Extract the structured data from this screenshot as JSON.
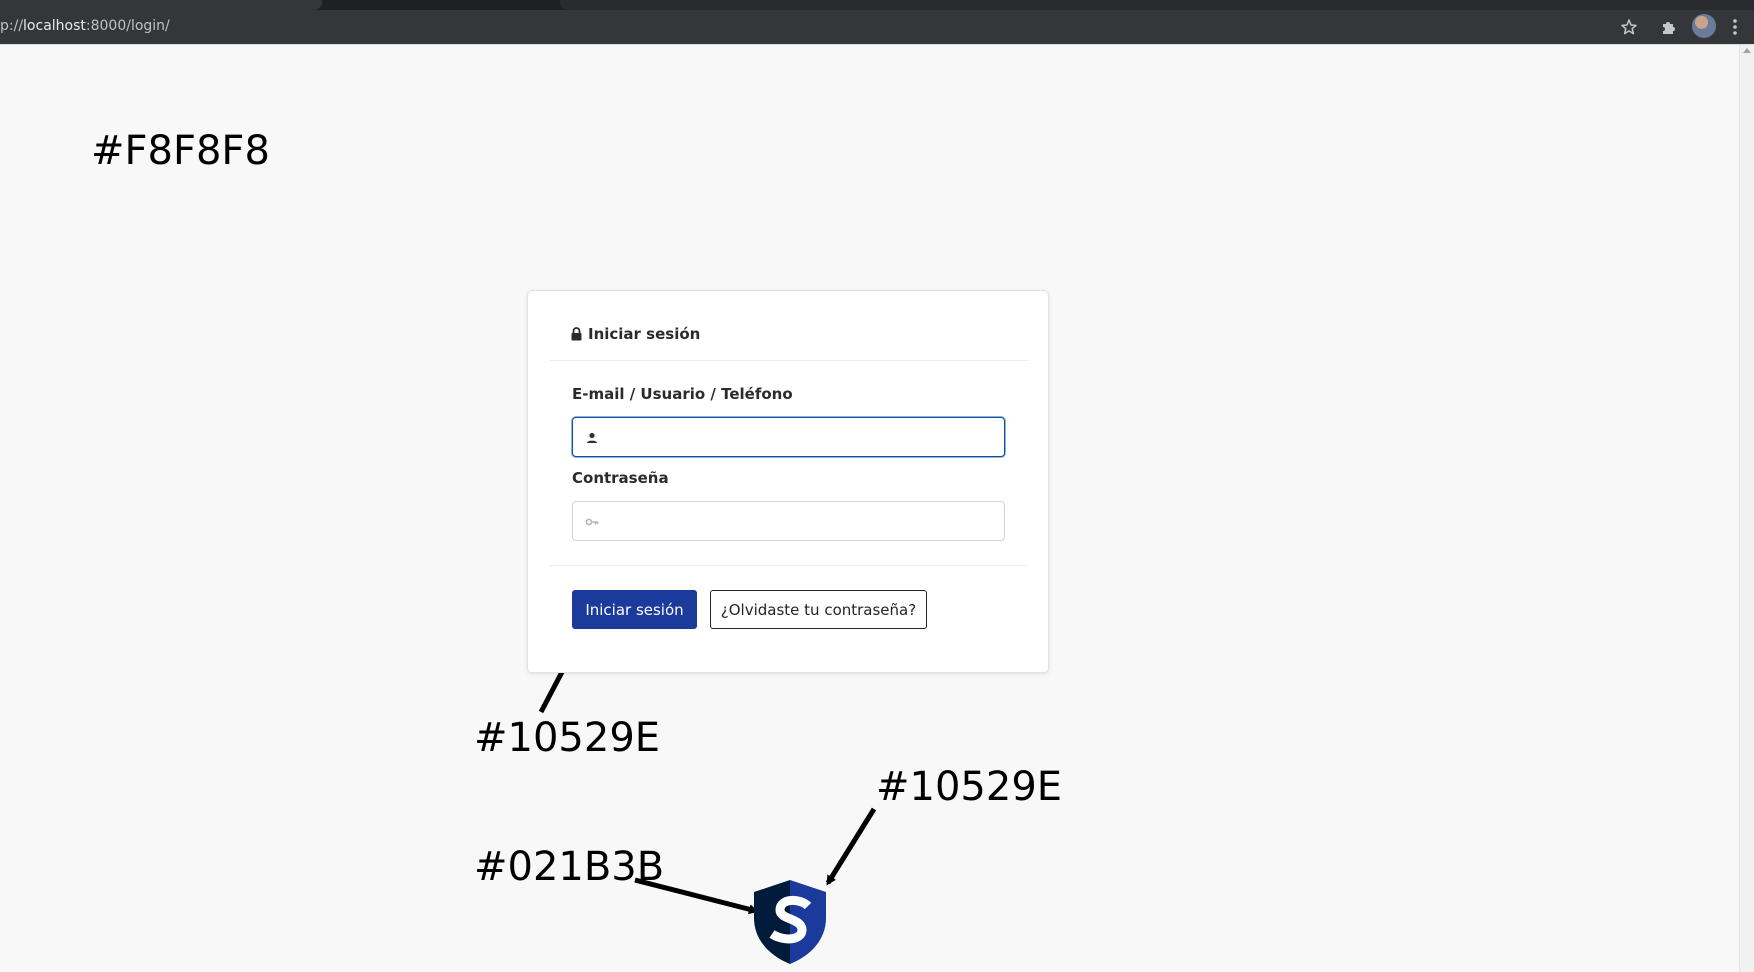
{
  "browser": {
    "url_prefix": "p://",
    "url_host": "localhost",
    "url_rest": ":8000/login/"
  },
  "annotations": {
    "page_bg": "#F8F8F8",
    "card_bg": "#FFFFFF",
    "button_color": "#10529E",
    "logo_light": "#10529E",
    "logo_dark": "#021B3B"
  },
  "login": {
    "title": "Iniciar sesión",
    "username_label": "E-mail / Usuario / Teléfono",
    "username_value": "",
    "password_label": "Contraseña",
    "password_value": "",
    "submit_label": "Iniciar sesión",
    "forgot_label": "¿Olvidaste tu contraseña?"
  },
  "colors": {
    "page_background": "#f8f8f8",
    "card_background": "#ffffff",
    "primary": "#10529e",
    "logo_dark": "#021b3b"
  },
  "icons": {
    "lock": "lock-icon",
    "user": "user-icon",
    "key": "key-icon",
    "star": "star-icon",
    "extensions": "puzzle-icon",
    "menu": "kebab-menu-icon",
    "logo": "shield-logo-icon"
  }
}
